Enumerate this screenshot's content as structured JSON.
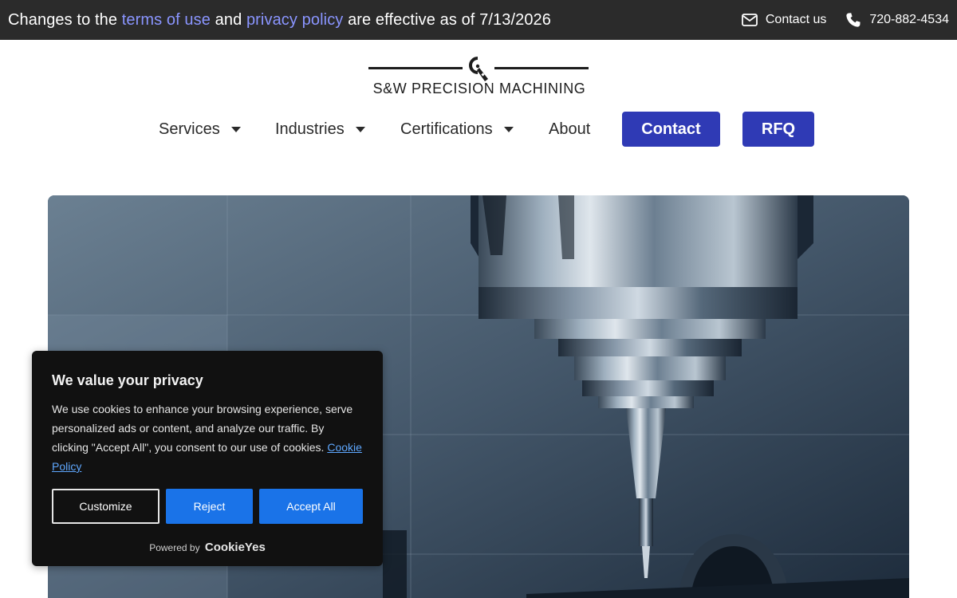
{
  "topbar": {
    "notice_prefix": "Changes to the ",
    "terms_link": "terms of use",
    "notice_and": " and ",
    "privacy_link": "privacy policy",
    "notice_suffix": " are effective as of 7/13/2026",
    "contact_label": "Contact us",
    "phone": "720-882-4534",
    "link_color": "#8a95ff",
    "icons": [
      "envelope-icon",
      "phone-icon"
    ]
  },
  "logo": {
    "wordmark": "S&W PRECISION MACHINING"
  },
  "nav": {
    "items": [
      {
        "label": "Services",
        "has_dropdown": true
      },
      {
        "label": "Industries",
        "has_dropdown": true
      },
      {
        "label": "Certifications",
        "has_dropdown": true
      },
      {
        "label": "About",
        "has_dropdown": false
      }
    ],
    "contact_button": "Contact",
    "rfq_button": "RFQ",
    "button_color": "#2f3ab5"
  },
  "cookie_banner": {
    "title": "We value your privacy",
    "body": "We use cookies to enhance your browsing experience, serve personalized ads or content, and analyze our traffic. By clicking \"Accept All\", you consent to our use of cookies.",
    "policy_link": "Cookie Policy",
    "customize_label": "Customize",
    "reject_label": "Reject",
    "accept_label": "Accept All",
    "powered_by": "Powered by",
    "powered_brand": "CookieYes",
    "accent_color": "#1a73e8"
  }
}
